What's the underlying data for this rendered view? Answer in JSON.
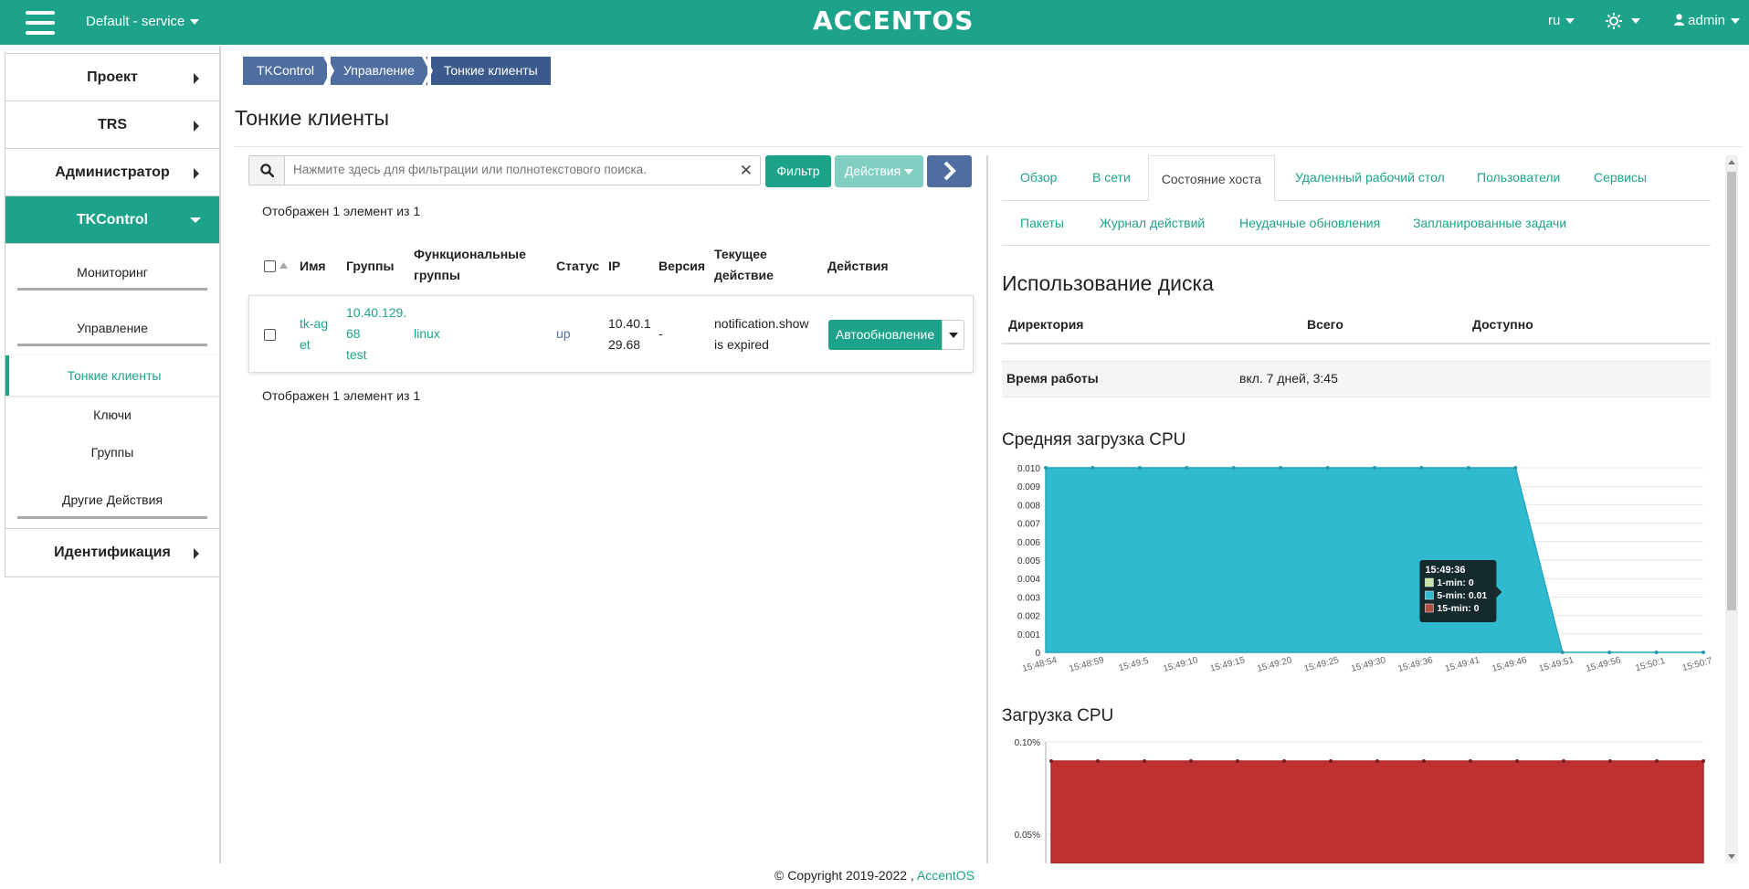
{
  "topbar": {
    "project": "Default - service",
    "logo": "ACCENTOS",
    "lang": "ru",
    "user": "admin"
  },
  "sidebar": {
    "items": [
      {
        "label": "Проект"
      },
      {
        "label": "TRS"
      },
      {
        "label": "Администратор"
      },
      {
        "label": "TKControl"
      }
    ],
    "sub": {
      "monitoring": "Мониторинг",
      "management": "Управление",
      "thin_clients": "Тонкие клиенты",
      "keys": "Ключи",
      "groups": "Группы",
      "other": "Другие Действия"
    },
    "identity": "Идентификация"
  },
  "breadcrumb": [
    "TKControl",
    "Управление",
    "Тонкие клиенты"
  ],
  "page_title": "Тонкие клиенты",
  "search": {
    "placeholder": "Нажмите здесь для фильтрации или полнотекстового поиска.",
    "filter_label": "Фильтр",
    "actions_label": "Действия"
  },
  "count_text": "Отображен 1 элемент из 1",
  "table": {
    "headers": {
      "name": "Имя",
      "groups": "Группы",
      "func1": "Функциональные",
      "func2": "группы",
      "status": "Статус",
      "ip": "IP",
      "version": "Версия",
      "cur1": "Текущее",
      "cur2": "действие",
      "actions": "Действия"
    },
    "row": {
      "name1": "tk-ag",
      "name2": "et",
      "group1": "10.40.129.",
      "group2": "68",
      "group3": "test",
      "func": "linux",
      "status": "up",
      "ip1": "10.40.1",
      "ip2": "29.68",
      "version": "-",
      "cur1": "notification.show",
      "cur2": "is expired",
      "action": "Автообновление"
    }
  },
  "tabs": {
    "overview": "Обзор",
    "network": "В сети",
    "host_state": "Состояние хоста",
    "remote": "Удаленный рабочий стол",
    "users": "Пользователи",
    "services": "Сервисы",
    "packages": "Пакеты",
    "journal": "Журнал действий",
    "failed": "Неудачные обновления",
    "scheduled": "Запланированные задачи"
  },
  "disk": {
    "title": "Использование диска",
    "col_dir": "Директория",
    "col_total": "Всего",
    "col_avail": "Доступно",
    "uptime_label": "Время работы",
    "uptime_value": "вкл. 7 дней, 3:45"
  },
  "cpu_avg_title": "Средняя загрузка CPU",
  "cpu_title": "Загрузка CPU",
  "footer": {
    "copyright": "© Copyright 2019-2022 ,",
    "brand": "AccentOS"
  },
  "colors": {
    "accent": "#1da38a",
    "nav": "#4f6ea0",
    "chart_area": "#2fbad0",
    "cpu_area": "#c13030"
  },
  "chart_data": [
    {
      "type": "area",
      "title": "Средняя загрузка CPU",
      "x": [
        "15:48:54",
        "15:48:59",
        "15:49:5",
        "15:49:10",
        "15:49:15",
        "15:49:20",
        "15:49:25",
        "15:49:30",
        "15:49:36",
        "15:49:41",
        "15:49:46",
        "15:49:51",
        "15:49:56",
        "15:50:1",
        "15:50:7"
      ],
      "y_ticks": [
        "0",
        "0.001",
        "0.002",
        "0.003",
        "0.004",
        "0.005",
        "0.006",
        "0.007",
        "0.008",
        "0.009",
        "0.010"
      ],
      "ylim": [
        0,
        0.01
      ],
      "series": [
        {
          "name": "5-min",
          "values": [
            0.01,
            0.01,
            0.01,
            0.01,
            0.01,
            0.01,
            0.01,
            0.01,
            0.01,
            0.01,
            0.01,
            0,
            0,
            0,
            0
          ]
        }
      ],
      "tooltip": {
        "time": "15:49:36",
        "lines": [
          "1-min: 0",
          "5-min: 0.01",
          "15-min: 0"
        ]
      }
    },
    {
      "type": "area",
      "title": "Загрузка CPU",
      "y_ticks": [
        "0.05%",
        "0.10%"
      ],
      "series": [
        {
          "values": [
            0.1,
            0.1,
            0.1,
            0.1,
            0.1,
            0.1,
            0.1,
            0.1,
            0.1,
            0.1,
            0.1,
            0.1,
            0.1,
            0.1,
            0.1
          ]
        }
      ]
    }
  ]
}
